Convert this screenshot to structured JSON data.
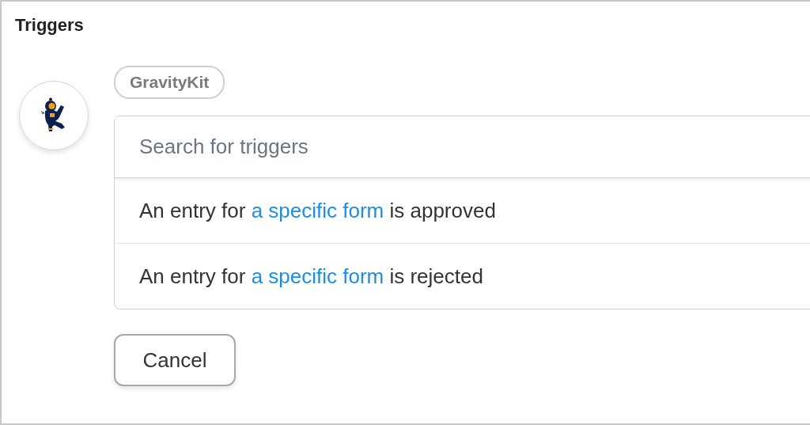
{
  "title": "Triggers",
  "integration": {
    "tag": "GravityKit"
  },
  "search": {
    "placeholder": "Search for triggers"
  },
  "triggers": [
    {
      "prefix": "An entry for ",
      "link": "a specific form",
      "suffix": " is approved"
    },
    {
      "prefix": "An entry for ",
      "link": "a specific form",
      "suffix": " is rejected"
    }
  ],
  "buttons": [
    "Cancel"
  ]
}
